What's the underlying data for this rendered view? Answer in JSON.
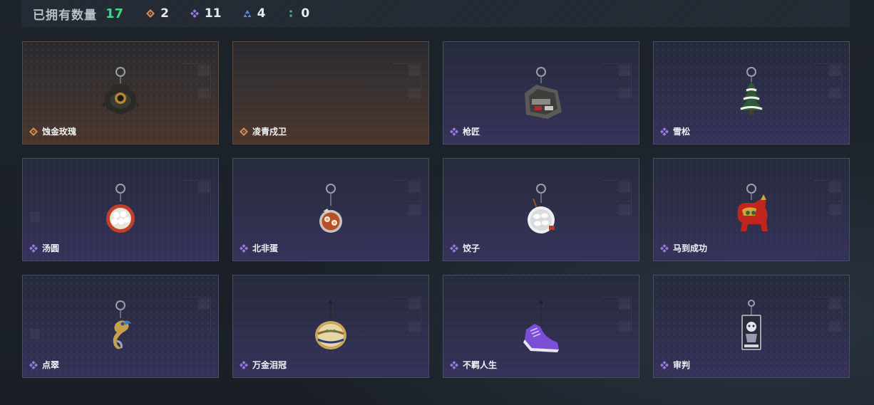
{
  "header": {
    "owned_label": "已拥有数量",
    "owned_total": "17",
    "stats": [
      {
        "icon": "orange-diamond-icon",
        "value": "2",
        "color": "#d58a52"
      },
      {
        "icon": "purple-diamond-icon",
        "value": "11",
        "color": "#9a7ae0"
      },
      {
        "icon": "blue-triangle-icon",
        "value": "4",
        "color": "#5a8fd8"
      },
      {
        "icon": "green-dots-icon",
        "value": "0",
        "color": "#3fbf8a"
      }
    ]
  },
  "colors": {
    "legendary": "#d58a52",
    "epic": "#9a7ae0",
    "accent_green": "#3fd68a"
  },
  "items": [
    {
      "name": "蚀金玫瑰",
      "rarity": "orange",
      "charm": "rose-charm-icon"
    },
    {
      "name": "凌青戍卫",
      "rarity": "orange",
      "charm": "empty"
    },
    {
      "name": "枪匠",
      "rarity": "purple",
      "charm": "gunsmith-charm-icon"
    },
    {
      "name": "雪松",
      "rarity": "purple",
      "charm": "pine-tree-charm-icon"
    },
    {
      "name": "汤圆",
      "rarity": "purple",
      "charm": "tangyuan-bowl-charm-icon"
    },
    {
      "name": "北非蛋",
      "rarity": "purple",
      "charm": "shakshuka-charm-icon"
    },
    {
      "name": "饺子",
      "rarity": "purple",
      "charm": "dumpling-plate-charm-icon"
    },
    {
      "name": "马到成功",
      "rarity": "purple",
      "charm": "red-horse-charm-icon"
    },
    {
      "name": "点翠",
      "rarity": "purple",
      "charm": "phoenix-charm-icon"
    },
    {
      "name": "万金泪冠",
      "rarity": "purple",
      "charm": "golden-crown-charm-icon"
    },
    {
      "name": "不羁人生",
      "rarity": "purple",
      "charm": "sneaker-charm-icon"
    },
    {
      "name": "审判",
      "rarity": "purple",
      "charm": "judgment-card-charm-icon"
    }
  ]
}
